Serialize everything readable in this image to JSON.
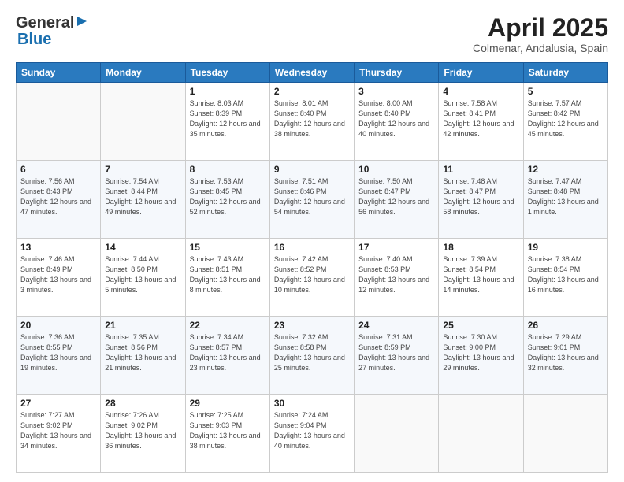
{
  "logo": {
    "general": "General",
    "blue": "Blue"
  },
  "title": "April 2025",
  "subtitle": "Colmenar, Andalusia, Spain",
  "days_of_week": [
    "Sunday",
    "Monday",
    "Tuesday",
    "Wednesday",
    "Thursday",
    "Friday",
    "Saturday"
  ],
  "weeks": [
    [
      {
        "day": "",
        "info": ""
      },
      {
        "day": "",
        "info": ""
      },
      {
        "day": "1",
        "info": "Sunrise: 8:03 AM\nSunset: 8:39 PM\nDaylight: 12 hours and 35 minutes."
      },
      {
        "day": "2",
        "info": "Sunrise: 8:01 AM\nSunset: 8:40 PM\nDaylight: 12 hours and 38 minutes."
      },
      {
        "day": "3",
        "info": "Sunrise: 8:00 AM\nSunset: 8:40 PM\nDaylight: 12 hours and 40 minutes."
      },
      {
        "day": "4",
        "info": "Sunrise: 7:58 AM\nSunset: 8:41 PM\nDaylight: 12 hours and 42 minutes."
      },
      {
        "day": "5",
        "info": "Sunrise: 7:57 AM\nSunset: 8:42 PM\nDaylight: 12 hours and 45 minutes."
      }
    ],
    [
      {
        "day": "6",
        "info": "Sunrise: 7:56 AM\nSunset: 8:43 PM\nDaylight: 12 hours and 47 minutes."
      },
      {
        "day": "7",
        "info": "Sunrise: 7:54 AM\nSunset: 8:44 PM\nDaylight: 12 hours and 49 minutes."
      },
      {
        "day": "8",
        "info": "Sunrise: 7:53 AM\nSunset: 8:45 PM\nDaylight: 12 hours and 52 minutes."
      },
      {
        "day": "9",
        "info": "Sunrise: 7:51 AM\nSunset: 8:46 PM\nDaylight: 12 hours and 54 minutes."
      },
      {
        "day": "10",
        "info": "Sunrise: 7:50 AM\nSunset: 8:47 PM\nDaylight: 12 hours and 56 minutes."
      },
      {
        "day": "11",
        "info": "Sunrise: 7:48 AM\nSunset: 8:47 PM\nDaylight: 12 hours and 58 minutes."
      },
      {
        "day": "12",
        "info": "Sunrise: 7:47 AM\nSunset: 8:48 PM\nDaylight: 13 hours and 1 minute."
      }
    ],
    [
      {
        "day": "13",
        "info": "Sunrise: 7:46 AM\nSunset: 8:49 PM\nDaylight: 13 hours and 3 minutes."
      },
      {
        "day": "14",
        "info": "Sunrise: 7:44 AM\nSunset: 8:50 PM\nDaylight: 13 hours and 5 minutes."
      },
      {
        "day": "15",
        "info": "Sunrise: 7:43 AM\nSunset: 8:51 PM\nDaylight: 13 hours and 8 minutes."
      },
      {
        "day": "16",
        "info": "Sunrise: 7:42 AM\nSunset: 8:52 PM\nDaylight: 13 hours and 10 minutes."
      },
      {
        "day": "17",
        "info": "Sunrise: 7:40 AM\nSunset: 8:53 PM\nDaylight: 13 hours and 12 minutes."
      },
      {
        "day": "18",
        "info": "Sunrise: 7:39 AM\nSunset: 8:54 PM\nDaylight: 13 hours and 14 minutes."
      },
      {
        "day": "19",
        "info": "Sunrise: 7:38 AM\nSunset: 8:54 PM\nDaylight: 13 hours and 16 minutes."
      }
    ],
    [
      {
        "day": "20",
        "info": "Sunrise: 7:36 AM\nSunset: 8:55 PM\nDaylight: 13 hours and 19 minutes."
      },
      {
        "day": "21",
        "info": "Sunrise: 7:35 AM\nSunset: 8:56 PM\nDaylight: 13 hours and 21 minutes."
      },
      {
        "day": "22",
        "info": "Sunrise: 7:34 AM\nSunset: 8:57 PM\nDaylight: 13 hours and 23 minutes."
      },
      {
        "day": "23",
        "info": "Sunrise: 7:32 AM\nSunset: 8:58 PM\nDaylight: 13 hours and 25 minutes."
      },
      {
        "day": "24",
        "info": "Sunrise: 7:31 AM\nSunset: 8:59 PM\nDaylight: 13 hours and 27 minutes."
      },
      {
        "day": "25",
        "info": "Sunrise: 7:30 AM\nSunset: 9:00 PM\nDaylight: 13 hours and 29 minutes."
      },
      {
        "day": "26",
        "info": "Sunrise: 7:29 AM\nSunset: 9:01 PM\nDaylight: 13 hours and 32 minutes."
      }
    ],
    [
      {
        "day": "27",
        "info": "Sunrise: 7:27 AM\nSunset: 9:02 PM\nDaylight: 13 hours and 34 minutes."
      },
      {
        "day": "28",
        "info": "Sunrise: 7:26 AM\nSunset: 9:02 PM\nDaylight: 13 hours and 36 minutes."
      },
      {
        "day": "29",
        "info": "Sunrise: 7:25 AM\nSunset: 9:03 PM\nDaylight: 13 hours and 38 minutes."
      },
      {
        "day": "30",
        "info": "Sunrise: 7:24 AM\nSunset: 9:04 PM\nDaylight: 13 hours and 40 minutes."
      },
      {
        "day": "",
        "info": ""
      },
      {
        "day": "",
        "info": ""
      },
      {
        "day": "",
        "info": ""
      }
    ]
  ]
}
